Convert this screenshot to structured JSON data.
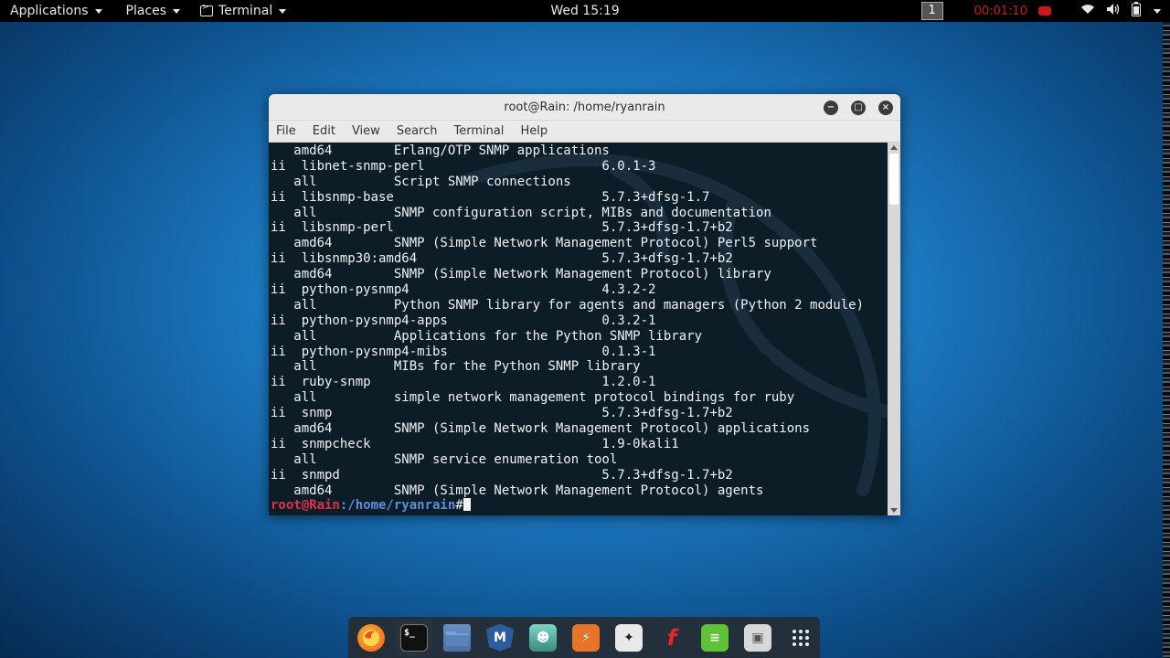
{
  "topbar": {
    "applications": "Applications",
    "places": "Places",
    "terminal": "Terminal",
    "clock": "Wed 15:19",
    "workspace": "1",
    "record_time": "00:01:10"
  },
  "window": {
    "title": "root@Rain: /home/ryanrain",
    "menu": [
      "File",
      "Edit",
      "View",
      "Search",
      "Terminal",
      "Help"
    ]
  },
  "terminal": {
    "lines": [
      "   amd64        Erlang/OTP SNMP applications",
      "ii  libnet-snmp-perl                       6.0.1-3",
      "   all          Script SNMP connections",
      "ii  libsnmp-base                           5.7.3+dfsg-1.7",
      "   all          SNMP configuration script, MIBs and documentation",
      "ii  libsnmp-perl                           5.7.3+dfsg-1.7+b2",
      "   amd64        SNMP (Simple Network Management Protocol) Perl5 support",
      "ii  libsnmp30:amd64                        5.7.3+dfsg-1.7+b2",
      "   amd64        SNMP (Simple Network Management Protocol) library",
      "ii  python-pysnmp4                         4.3.2-2",
      "   all          Python SNMP library for agents and managers (Python 2 module)",
      "ii  python-pysnmp4-apps                    0.3.2-1",
      "   all          Applications for the Python SNMP library",
      "ii  python-pysnmp4-mibs                    0.1.3-1",
      "   all          MIBs for the Python SNMP library",
      "ii  ruby-snmp                              1.2.0-1",
      "   all          simple network management protocol bindings for ruby",
      "ii  snmp                                   5.7.3+dfsg-1.7+b2",
      "   amd64        SNMP (Simple Network Management Protocol) applications",
      "ii  snmpcheck                              1.9-0kali1",
      "   all          SNMP service enumeration tool",
      "ii  snmpd                                  5.7.3+dfsg-1.7+b2",
      "   amd64        SNMP (Simple Network Management Protocol) agents"
    ],
    "prompt_user": "root@Rain",
    "prompt_path": ":/home/ryanrain",
    "prompt_hash": "#"
  },
  "dock": {
    "icons": [
      {
        "name": "firefox-icon",
        "glyph": "◉"
      },
      {
        "name": "terminal-icon",
        "glyph": "$_"
      },
      {
        "name": "files-icon",
        "glyph": ""
      },
      {
        "name": "metasploit-icon",
        "glyph": "M"
      },
      {
        "name": "armitage-icon",
        "glyph": "☻"
      },
      {
        "name": "burpsuite-icon",
        "glyph": "⚡"
      },
      {
        "name": "maltego-icon",
        "glyph": "✦"
      },
      {
        "name": "faraday-icon",
        "glyph": "f"
      },
      {
        "name": "leafpad-icon",
        "glyph": "≡"
      },
      {
        "name": "screenshot-icon",
        "glyph": "▣"
      },
      {
        "name": "show-apps-icon",
        "glyph": "⠿"
      }
    ]
  },
  "colors": {
    "prompt_user": "#e0314a",
    "prompt_path": "#5b8fd6",
    "terminal_bg": "#0c1d28",
    "record": "#cc1a1a"
  }
}
